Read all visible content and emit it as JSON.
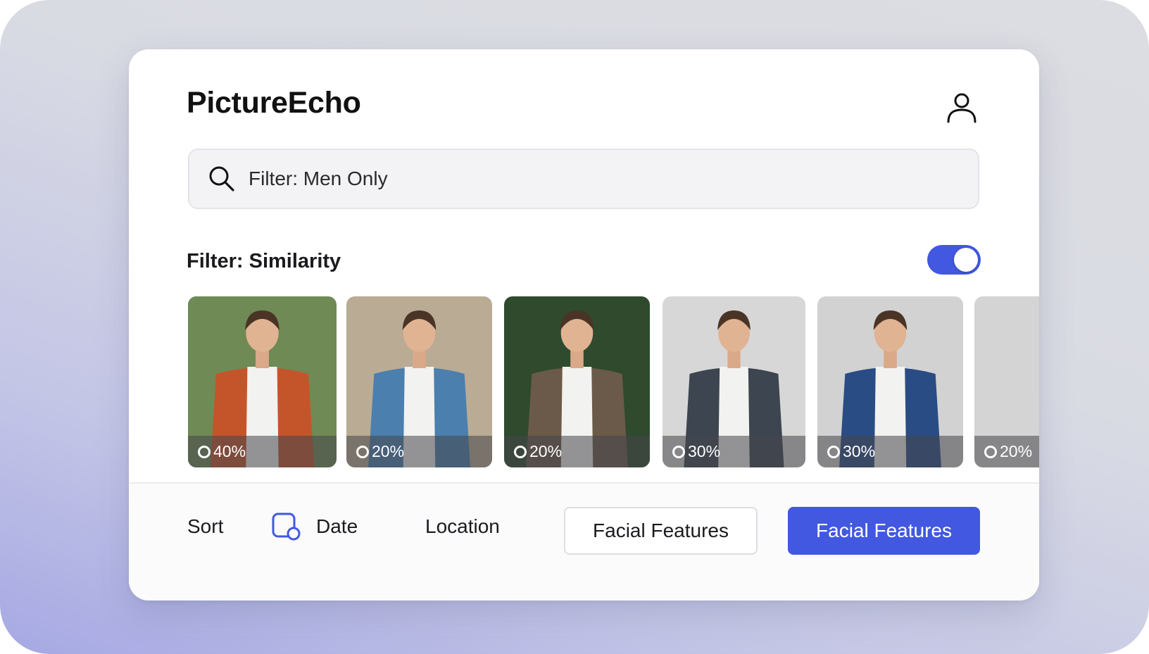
{
  "app": {
    "title": "PictureEcho",
    "profile_icon": "user-icon"
  },
  "search": {
    "icon": "search-icon",
    "value": "Filter: Men Only"
  },
  "similarity": {
    "label": "Filter: Similarity",
    "enabled": true
  },
  "thumbnails": [
    {
      "score": "40%",
      "jacket": "#c4552b",
      "bg": "#6f8a55",
      "selected": true
    },
    {
      "score": "20%",
      "jacket": "#4a7fae",
      "bg": "#b9ab94",
      "selected": false
    },
    {
      "score": "20%",
      "jacket": "#6b5a49",
      "bg": "#2f4a2d",
      "selected": false
    },
    {
      "score": "30%",
      "jacket": "#3c4550",
      "bg": "#d7d7d7",
      "selected": false
    },
    {
      "score": "30%",
      "jacket": "#2a4c84",
      "bg": "#d2d2d2",
      "selected": false
    },
    {
      "score": "20%",
      "jacket": "#1e3566",
      "bg": "#d4d4d4",
      "selected": false
    }
  ],
  "sort": {
    "label": "Sort",
    "date_label": "Date",
    "location_label": "Location",
    "facial_outline_label": "Facial Features",
    "facial_primary_label": "Facial Features"
  },
  "colors": {
    "accent": "#4258e0"
  }
}
